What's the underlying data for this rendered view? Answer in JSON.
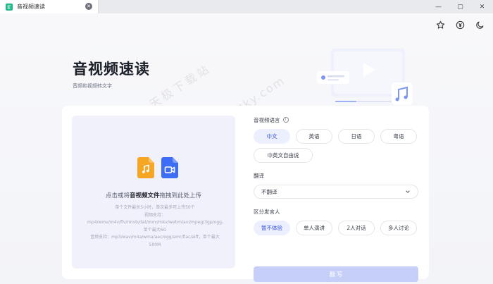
{
  "tab": {
    "title": "音视频速读"
  },
  "window_controls": [
    "—",
    "▢",
    "✕"
  ],
  "top_icons": [
    "star-icon",
    "currency-icon",
    "moon-icon"
  ],
  "hero": {
    "title": "音视频速读",
    "subtitle": "音频和视频转文字"
  },
  "watermark": {
    "line1": "天极下载站",
    "line2": "mydown.yesky.com"
  },
  "upload": {
    "prefix": "点击或将",
    "highlight": "音视频文件",
    "suffix": "拖拽到此处上传",
    "hints": [
      "单个文件最长5小时，单次最多可上传50个",
      "视频支持：mp4/wmv/m4v/flv/rmvb/dat/mov/mkv/webm/avi/mpeg/3gp/ogg，单个最大6G",
      "音频支持：mp3/wav/m4a/wma/aac/ogg/amr/flac/aiff，单个最大500M"
    ]
  },
  "language": {
    "label": "音视频语言",
    "options": [
      "中文",
      "英语",
      "日语",
      "粤语",
      "中英文自由说"
    ],
    "selected": "中文"
  },
  "translate": {
    "label": "翻译",
    "value": "不翻译"
  },
  "speakers": {
    "label": "区分发言人",
    "options": [
      "暂不体验",
      "单人演讲",
      "2人对话",
      "多人讨论"
    ],
    "selected": "暂不体验"
  },
  "submit": {
    "label": "翻 写"
  },
  "colors": {
    "accent": "#3451e0",
    "audio_icon": "#f5a623",
    "video_icon": "#3d6cf5",
    "submit_disabled": "#c6cff8"
  }
}
